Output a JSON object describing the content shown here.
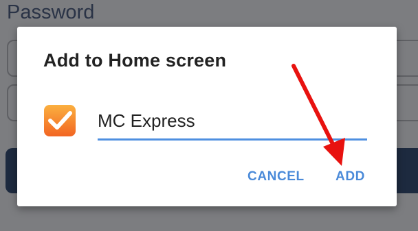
{
  "background": {
    "field_label": "Password"
  },
  "dialog": {
    "title": "Add to Home screen",
    "app_icon": "orange-checkbox-icon",
    "name_input_value": "MC Express",
    "cancel_label": "CANCEL",
    "add_label": "ADD"
  },
  "annotation": {
    "arrow_icon": "red-arrow-icon",
    "color": "#e8120f"
  },
  "colors": {
    "accent": "#4a8ad9",
    "underline": "#4e8fe0",
    "icon_orange": "#f7941d",
    "scrim": "#7c7d80"
  }
}
